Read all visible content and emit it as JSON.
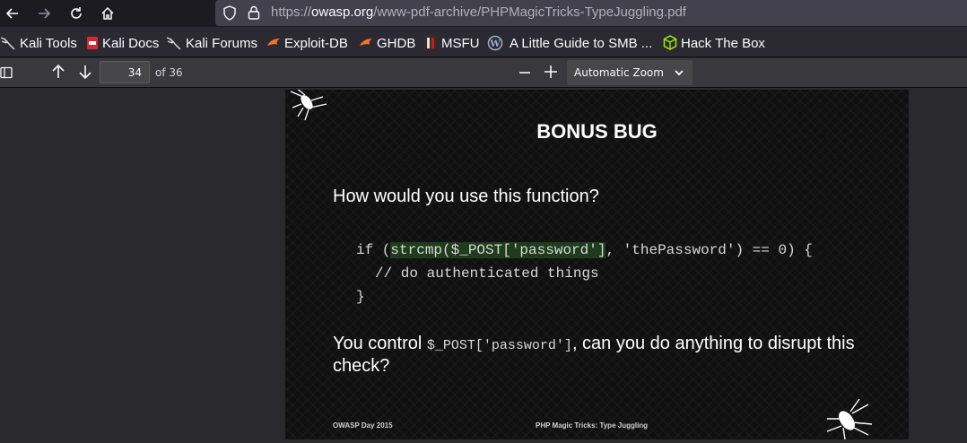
{
  "browser": {
    "url_prefix": "https://",
    "url_host": "owasp.org",
    "url_path": "/www-pdf-archive/PHPMagicTricks-TypeJuggling.pdf"
  },
  "bookmarks": [
    {
      "label": "Kali Tools",
      "icon": "kali-dragon-icon"
    },
    {
      "label": "Kali Docs",
      "icon": "kali-docs-icon"
    },
    {
      "label": "Kali Forums",
      "icon": "kali-dragon-icon"
    },
    {
      "label": "Exploit-DB",
      "icon": "exploit-db-icon"
    },
    {
      "label": "GHDB",
      "icon": "ghdb-icon"
    },
    {
      "label": "MSFU",
      "icon": "msfu-icon"
    },
    {
      "label": "A Little Guide to SMB ...",
      "icon": "wordpress-icon"
    },
    {
      "label": "Hack The Box",
      "icon": "htb-cube-icon"
    }
  ],
  "pdf_toolbar": {
    "page_number": "34",
    "page_count_text": "of 36",
    "zoom_label": "Automatic Zoom"
  },
  "slide": {
    "title": "BONUS BUG",
    "question": "How would you use this function?",
    "code_line1_pre": "if (",
    "code_line1_hl": "strcmp($_POST['password']",
    "code_line1_post": ", 'thePassword') == 0) {",
    "code_line2": "// do authenticated things",
    "code_line3": "}",
    "para_pre": "You control ",
    "para_code": "$_POST['password']",
    "para_post": ", can you do anything to disrupt this check?",
    "footer_left": "OWASP Day 2015",
    "footer_center": "PHP Magic Tricks: Type Juggling"
  },
  "colors": {
    "nav_bg": "#1c1b22",
    "url_bg": "#42414d",
    "toolbar_bg": "#38383d",
    "viewer_bg": "#2a2a2e",
    "code_highlight": "#1f3c1c"
  }
}
